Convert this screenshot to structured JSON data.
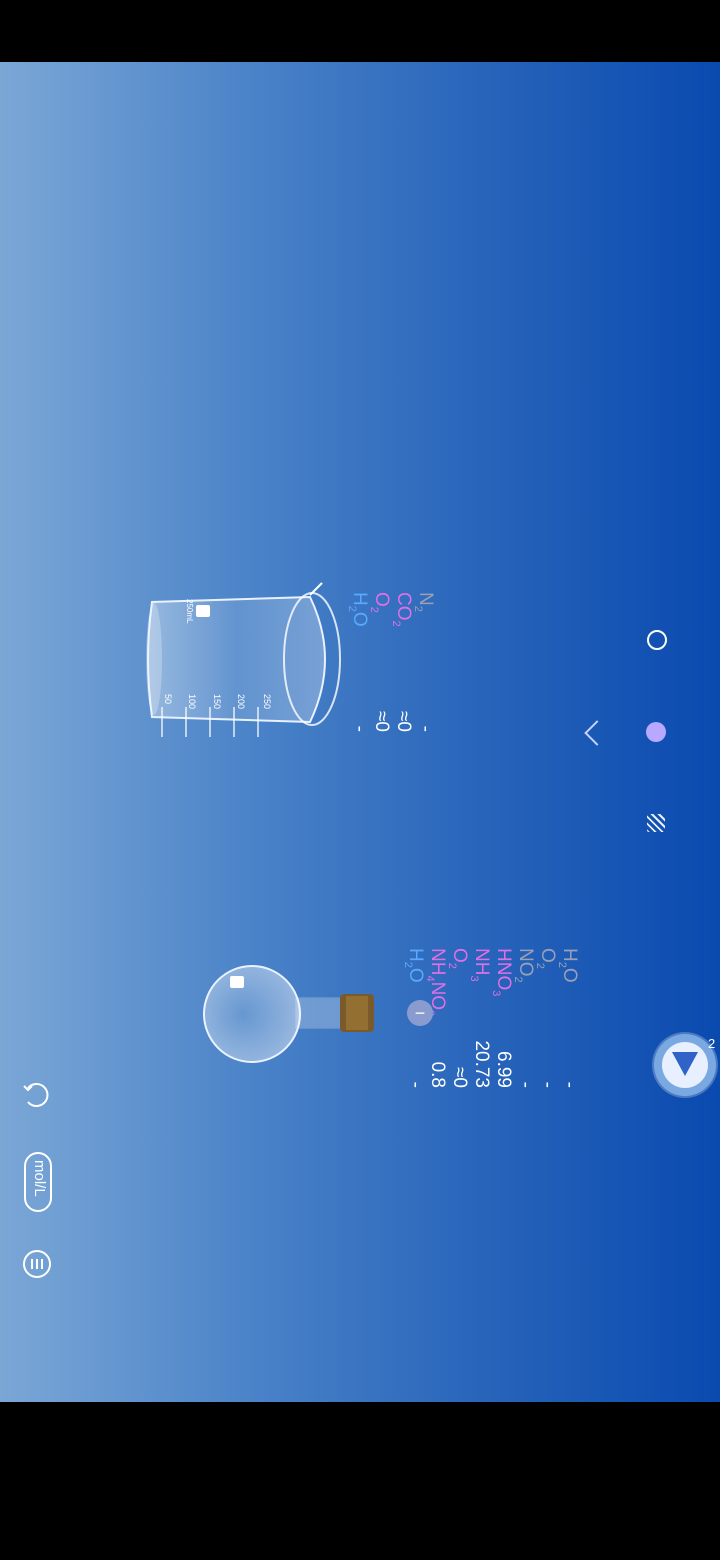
{
  "beaker": {
    "capacity_label": "250mL",
    "scale_marks": [
      "250",
      "200",
      "150",
      "100",
      "50"
    ],
    "species": [
      {
        "formula": "N",
        "sub": "2",
        "value": "-",
        "color": "#9aa0b5"
      },
      {
        "formula": "CO",
        "sub": "2",
        "value": "≈0",
        "color": "#e06fe6"
      },
      {
        "formula": "O",
        "sub": "2",
        "value": "≈0",
        "color": "#e06fe6"
      },
      {
        "formula": "H",
        "sub": "2",
        "tail": "O",
        "value": "-",
        "color": "#59a9ff"
      }
    ]
  },
  "flask": {
    "species": [
      {
        "formula": "H",
        "sub": "2",
        "tail": "O",
        "value": "-",
        "color": "#9aa0b5"
      },
      {
        "formula": "O",
        "sub": "2",
        "value": "-",
        "color": "#9aa0b5"
      },
      {
        "formula": "NO",
        "sub": "2",
        "value": "-",
        "color": "#9aa0b5"
      },
      {
        "formula": "HNO",
        "sub": "3",
        "value": "6.99",
        "color": "#e06fe6"
      },
      {
        "formula": "NH",
        "sub": "3",
        "value": "20.73",
        "color": "#e06fe6"
      },
      {
        "formula": "O",
        "sub": "2",
        "value": "≈0",
        "color": "#e06fe6"
      },
      {
        "formula": "NH",
        "sub": "4",
        "tail": "NO",
        "sub2": "3",
        "value": "0.8",
        "color": "#e06fe6"
      },
      {
        "formula": "H",
        "sub": "2",
        "tail": "O",
        "value": "-",
        "color": "#59a9ff"
      }
    ]
  },
  "toolbar": {
    "unit_label": "mol/L",
    "undo_icon": "undo-icon",
    "menu_icon": "menu-icon"
  },
  "nav": {
    "back_icon": "chevron-left-icon",
    "home_icon": "circle-outline-icon",
    "recent_icon": "stripes-icon"
  },
  "badge": {
    "count": "2"
  },
  "minus_label": "−"
}
